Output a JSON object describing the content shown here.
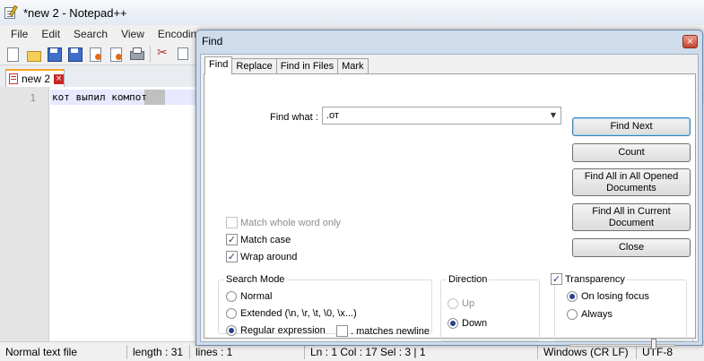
{
  "window": {
    "title": "*new 2 - Notepad++"
  },
  "menu": [
    "File",
    "Edit",
    "Search",
    "View",
    "Encoding"
  ],
  "toolbar_icons": [
    "new-file-icon",
    "open-file-icon",
    "save-icon",
    "save-all-icon",
    "close-file-icon",
    "close-all-icon",
    "print-icon",
    "cut-icon",
    "copy-icon"
  ],
  "document_tab": {
    "label": "new 2",
    "close": "×"
  },
  "editor": {
    "line_number": "1",
    "text": "кот выпил компот"
  },
  "statusbar": {
    "file_type": "Normal text file",
    "length": "length : 31",
    "lines": "lines : 1",
    "position": "Ln : 1    Col : 17    Sel : 3 | 1",
    "eol": "Windows (CR LF)",
    "encoding": "UTF-8"
  },
  "find_dialog": {
    "title": "Find",
    "close": "×",
    "tabs": [
      "Find",
      "Replace",
      "Find in Files",
      "Mark"
    ],
    "find_what_label": "Find what :",
    "find_what_value": ".от",
    "dropdown_glyph": "▼",
    "buttons": {
      "find_next": "Find Next",
      "count": "Count",
      "find_all_opened": "Find All in All Opened Documents",
      "find_all_current": "Find All in Current Document",
      "close": "Close"
    },
    "options": {
      "match_whole_word": {
        "label": "Match whole word only",
        "checked": false,
        "enabled": false
      },
      "match_case": {
        "label": "Match case",
        "checked": true,
        "enabled": true
      },
      "wrap_around": {
        "label": "Wrap around",
        "checked": true,
        "enabled": true
      }
    },
    "search_mode": {
      "title": "Search Mode",
      "normal": "Normal",
      "extended": "Extended (\\n, \\r, \\t, \\0, \\x...)",
      "regex": "Regular expression",
      "matches_newline": ". matches newline",
      "selected": "regex"
    },
    "direction": {
      "title": "Direction",
      "up": "Up",
      "down": "Down",
      "selected": "Down"
    },
    "transparency": {
      "label": "Transparency",
      "checked": true,
      "on_losing_focus": "On losing focus",
      "always": "Always",
      "selected": "On losing focus",
      "level": 0.8
    },
    "check_glyph": "✓"
  }
}
